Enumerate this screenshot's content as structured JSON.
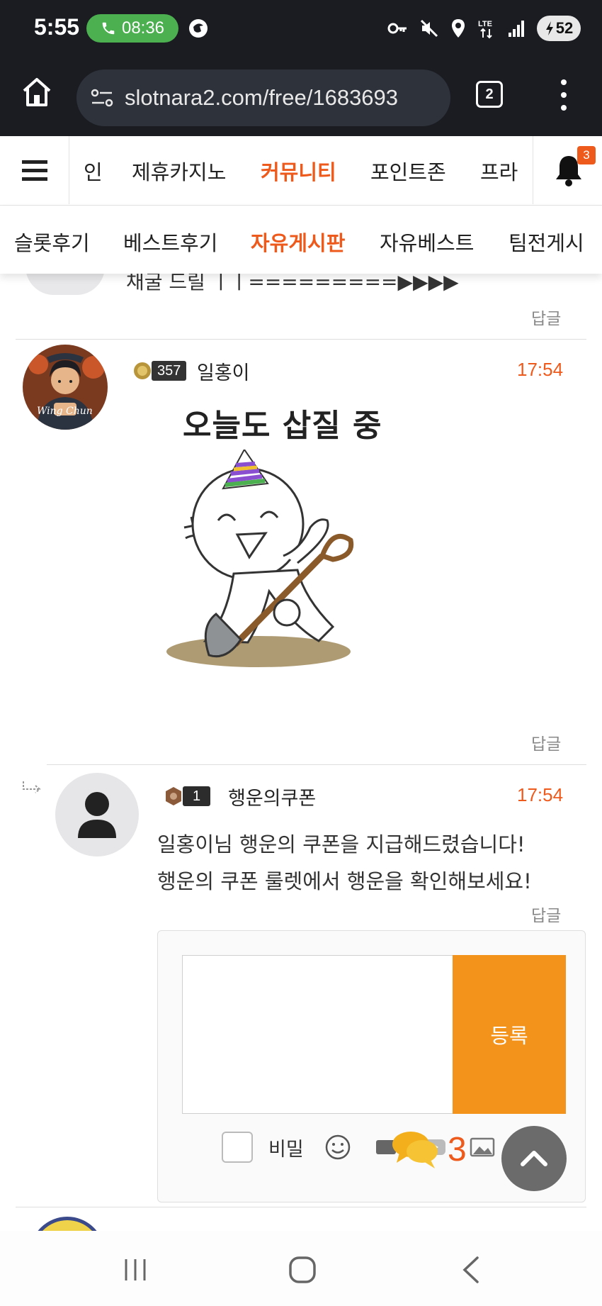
{
  "status_bar": {
    "time": "5:55",
    "call_timer": "08:36",
    "battery": "52"
  },
  "browser": {
    "url": "slotnara2.com/free/1683693",
    "tab_count": "2"
  },
  "site_nav": {
    "items": [
      "인",
      "제휴카지노",
      "커뮤니티",
      "포인트존",
      "프라"
    ],
    "active_index": 2,
    "bell_count": "3"
  },
  "sub_nav": {
    "items": [
      "슬롯후기",
      "베스트후기",
      "자유게시판",
      "자유베스트",
      "팀전게시"
    ],
    "active_index": 2
  },
  "comments": {
    "previous": {
      "text": "채굴 드릴 ㅣㅣ=========▶▶▶▶",
      "reply_label": "답글"
    },
    "first": {
      "level": "357",
      "author": "일홍이",
      "time": "17:54",
      "avatar_text": "Wing Chun",
      "sticker_caption": "오늘도 삽질 중",
      "reply_label": "답글"
    },
    "second": {
      "level": "1",
      "author": "행운의쿠폰",
      "time": "17:54",
      "line1": "일홍이님 행운의 쿠폰을 지급해드렸습니다!",
      "line2": "행운의 쿠폰 룰렛에서 행운을 확인해보세요!",
      "reply_label": "답글"
    }
  },
  "reply_form": {
    "submit_label": "등록",
    "secret_label": "비밀"
  },
  "floating": {
    "chat_count": "3"
  },
  "colors": {
    "accent": "#ee5a1c",
    "submit": "#f3931c",
    "dark_bar": "#1a1c22"
  }
}
